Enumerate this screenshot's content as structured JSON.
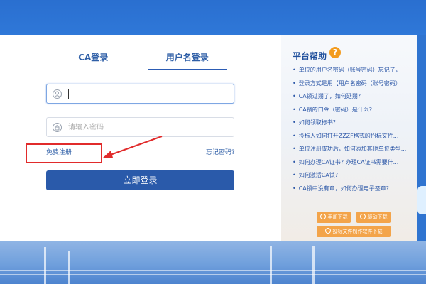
{
  "tabs": [
    {
      "label": "CA登录",
      "active": false
    },
    {
      "label": "用户名登录",
      "active": true
    }
  ],
  "form": {
    "username_value": "",
    "password_placeholder": "请输入密码",
    "register_link": "免费注册",
    "forgot_link": "忘记密码?",
    "login_button": "立即登录"
  },
  "help": {
    "title": "平台帮助",
    "question_mark": "?",
    "items": [
      "单位的用户名密码（账号密码）忘记了，",
      "登录方式是用【用户名密码（账号密码）",
      "CA锁过期了，如何延期?",
      "CA锁的口令（密码）是什么?",
      "如何领取标书?",
      "投标人如何打开ZZZF格式的招标文件...",
      "单位注册成功后，如何添加其他单位类型...",
      "如何办理CA证书? 办理CA证书需要什...",
      "如何激活CA锁?",
      "CA锁中没有章，如何办理电子签章?"
    ],
    "buttons": {
      "manual": "手册下载",
      "driver": "驱动下载",
      "software": "投标文件制作软件下载"
    }
  },
  "colors": {
    "primary": "#2a5aaa",
    "accent": "#f3a44a",
    "annotation": "#e12b2b",
    "background": "#2f74d0"
  }
}
